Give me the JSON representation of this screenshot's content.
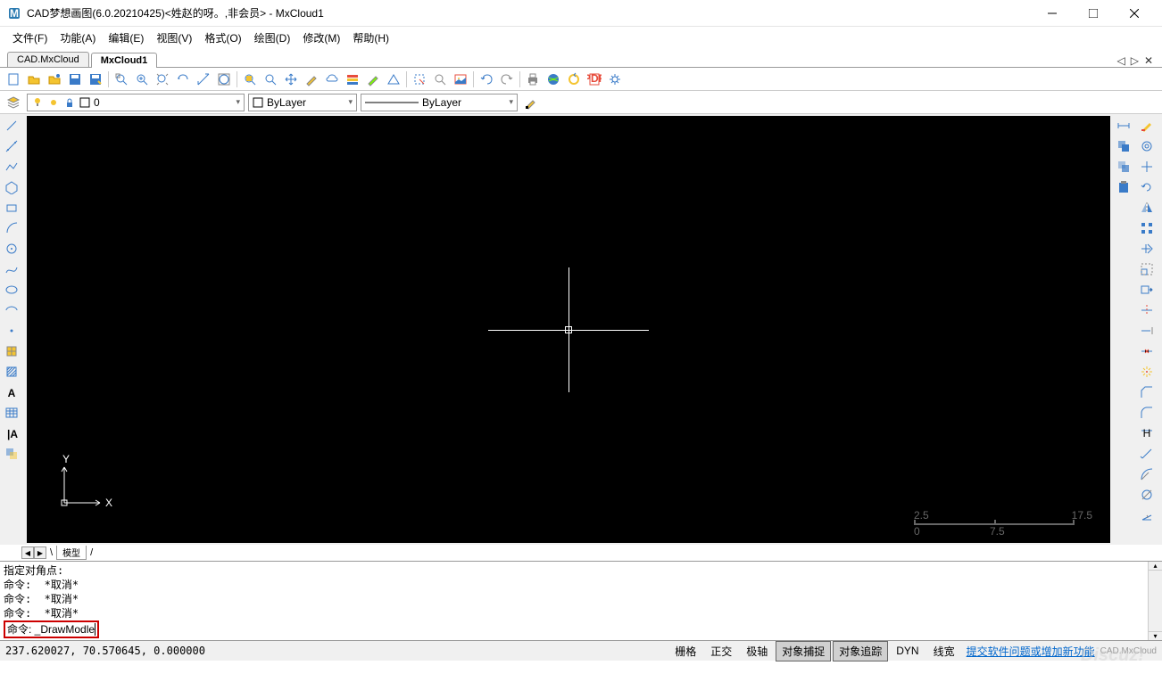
{
  "title": "CAD梦想画图(6.0.20210425)<姓赵的呀。,非会员> - MxCloud1",
  "menus": [
    "文件(F)",
    "功能(A)",
    "编辑(E)",
    "视图(V)",
    "格式(O)",
    "绘图(D)",
    "修改(M)",
    "帮助(H)"
  ],
  "doctabs": {
    "inactive": "CAD.MxCloud",
    "active": "MxCloud1"
  },
  "layer": {
    "current": "0",
    "color_sel": "ByLayer",
    "linetype": "ByLayer"
  },
  "ucs": {
    "y": "Y",
    "x": "X"
  },
  "scale": {
    "v0": "0",
    "v1": "7.5",
    "v2": "2.5",
    "v3": "17.5"
  },
  "modeltab": "模型",
  "cmd": {
    "l1": "指定对角点:",
    "l2": "命令:  *取消*",
    "l3": "命令:  *取消*",
    "l4": "命令:  *取消*",
    "prompt": "命令: ",
    "input": "_DrawModle"
  },
  "status": {
    "coords": "237.620027,  70.570645,  0.000000",
    "snap": "栅格",
    "ortho": "正交",
    "polar": "极轴",
    "osnap": "对象捕捉",
    "otrack": "对象追踪",
    "dyn": "DYN",
    "lwt": "线宽",
    "link": "提交软件问题或增加新功能"
  },
  "wm": "CAD.MxCloud",
  "wm2": "Discuz!"
}
